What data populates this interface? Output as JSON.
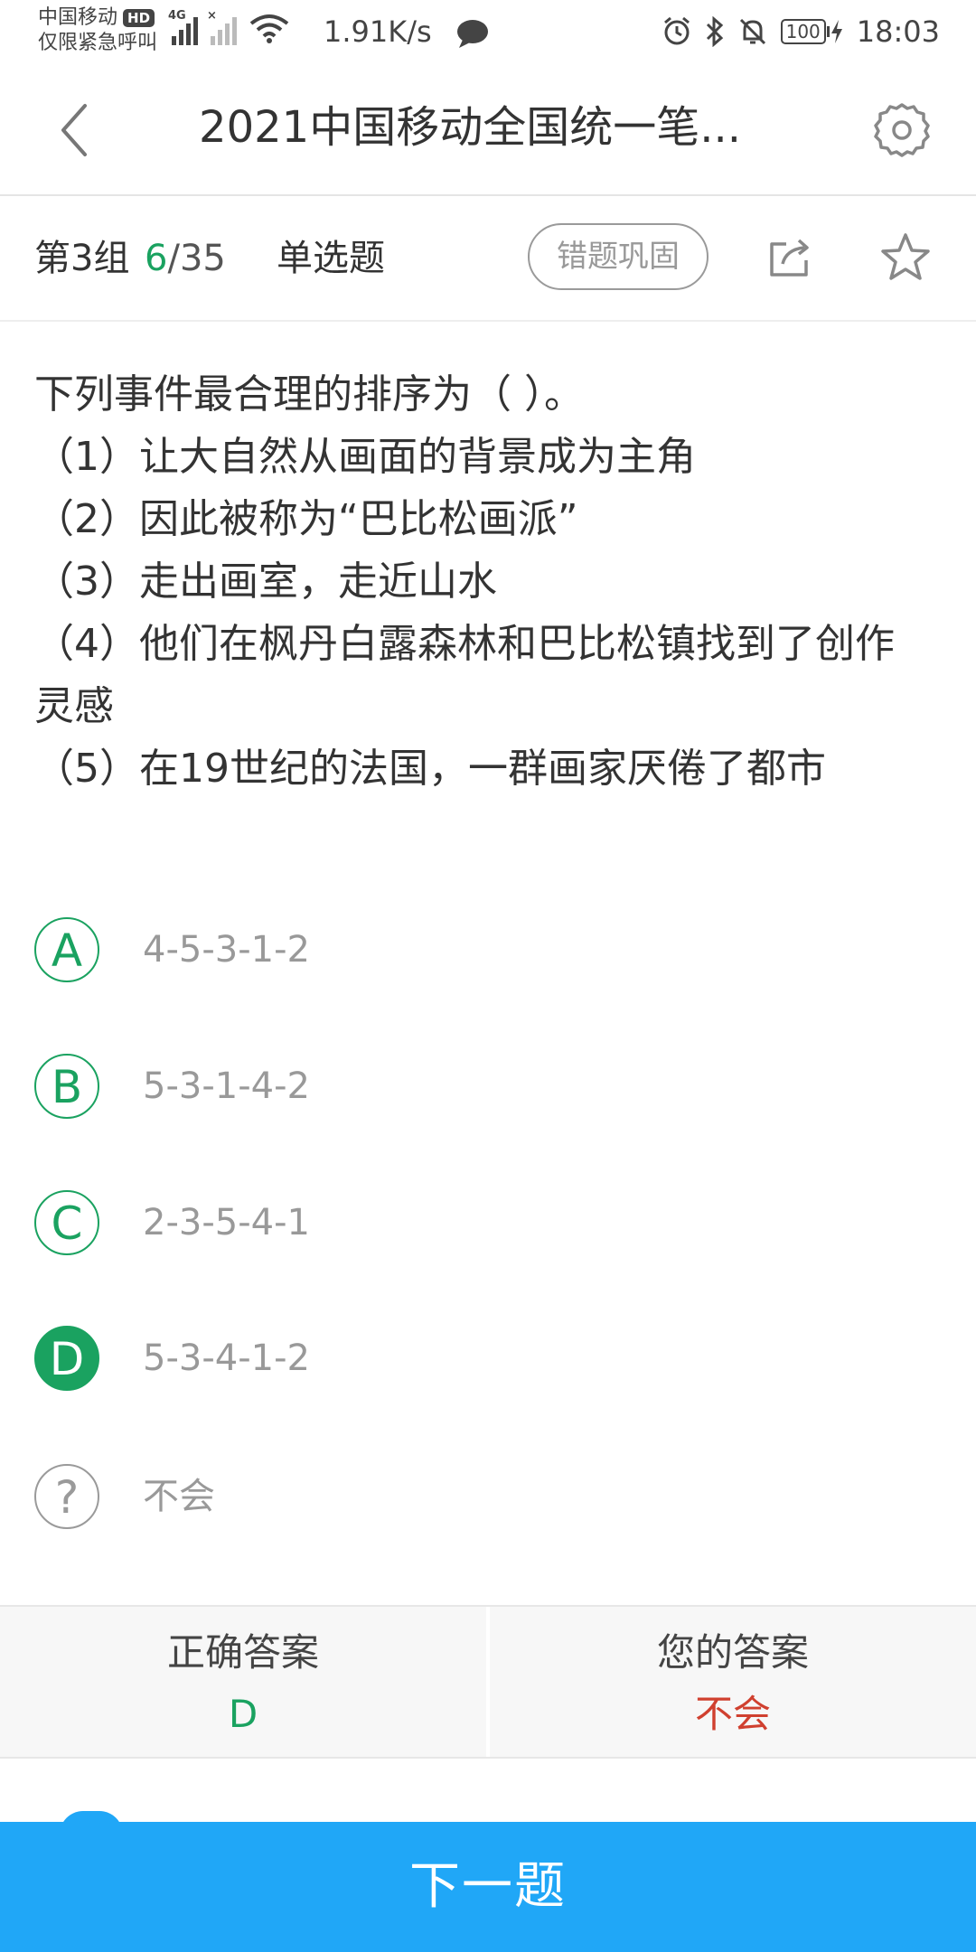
{
  "status_bar": {
    "carrier": "中国移动",
    "hd": "HD",
    "emergency": "仅限紧急呼叫",
    "net_tag": "4G",
    "net_speed": "1.91K/s",
    "battery": "100",
    "time": "18:03"
  },
  "header": {
    "title": "2021中国移动全国统一笔..."
  },
  "info_bar": {
    "group": "第3组",
    "current": "6",
    "separator": "/",
    "total": "35",
    "question_type": "单选题",
    "review_button": "错题巩固"
  },
  "question": {
    "lines": [
      "下列事件最合理的排序为（ ）。",
      "（1）让大自然从画面的背景成为主角",
      "（2）因此被称为“巴比松画派”",
      "（3）走出画室，走近山水",
      "（4）他们在枫丹白露森林和巴比松镇找到了创作",
      "灵感",
      "（5）在19世纪的法国，一群画家厌倦了都市"
    ]
  },
  "options": [
    {
      "letter": "A",
      "text": "4-5-3-1-2",
      "selected": false
    },
    {
      "letter": "B",
      "text": "5-3-1-4-2",
      "selected": false
    },
    {
      "letter": "C",
      "text": "2-3-5-4-1",
      "selected": false
    },
    {
      "letter": "D",
      "text": "5-3-4-1-2",
      "selected": true
    },
    {
      "letter": "?",
      "text": "不会",
      "selected": false
    }
  ],
  "answer": {
    "correct_label": "正确答案",
    "correct_value": "D",
    "yours_label": "您的答案",
    "yours_value": "不会"
  },
  "footer": {
    "next_button": "下一题"
  },
  "colors": {
    "accent_green": "#1aa260",
    "wrong_red": "#d0402f",
    "primary_blue": "#20a7f7"
  }
}
